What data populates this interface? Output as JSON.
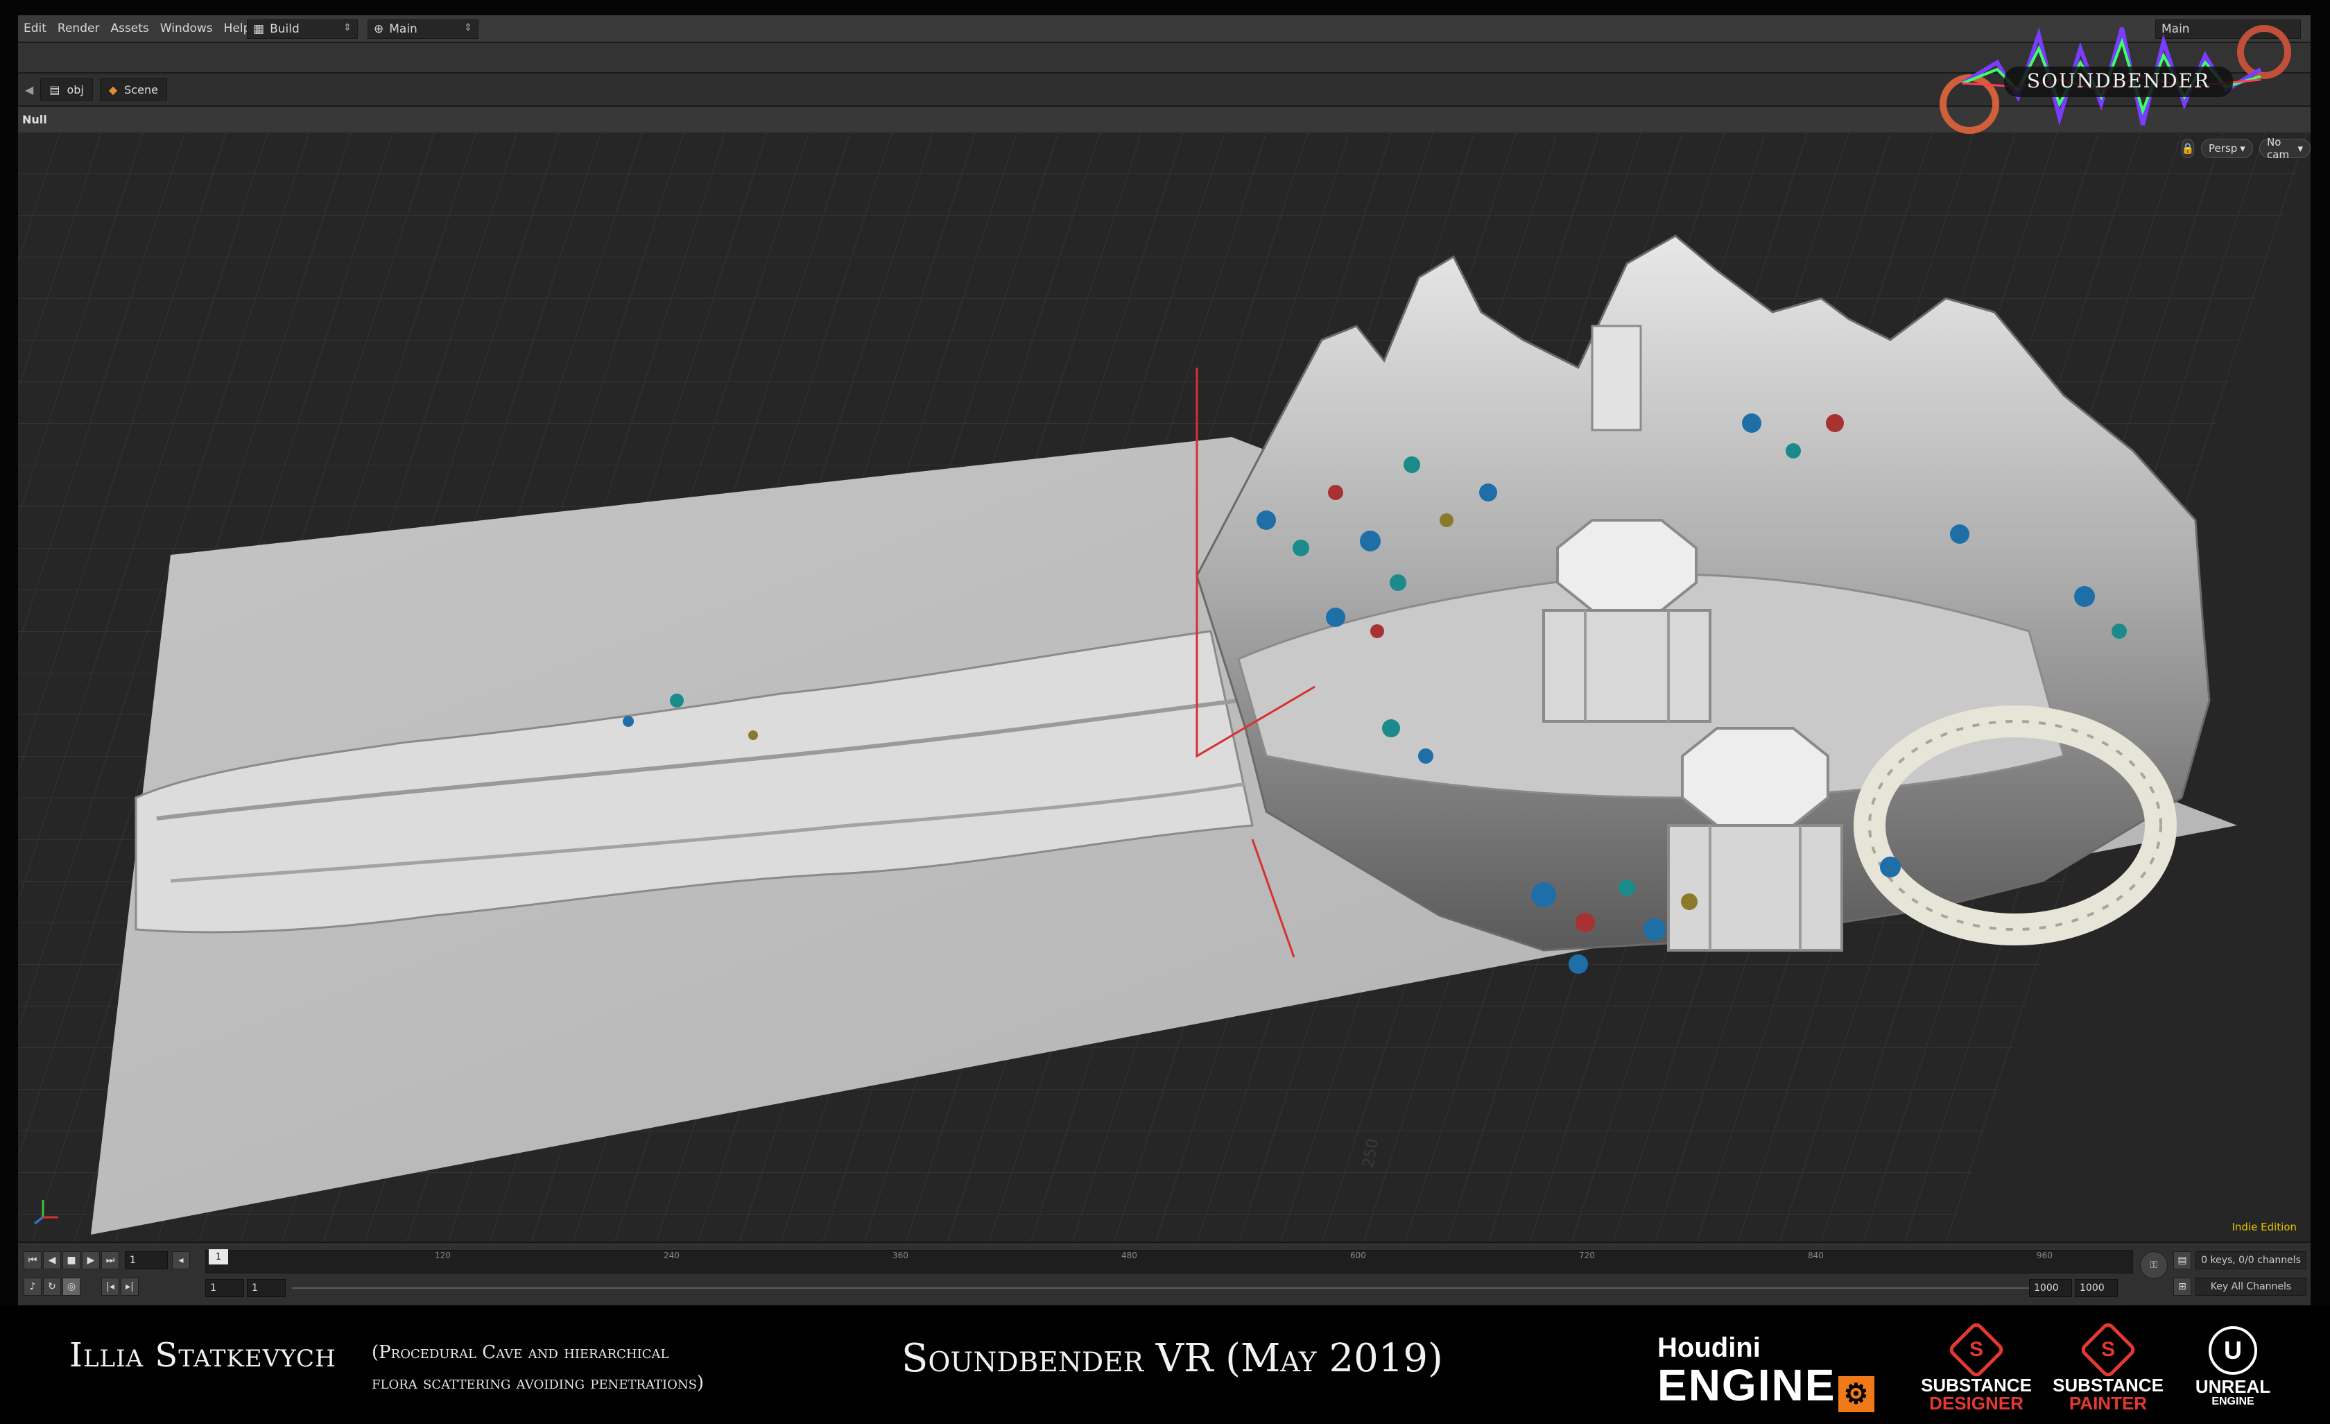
{
  "menubar": {
    "items": [
      "Edit",
      "Render",
      "Assets",
      "Windows",
      "Help"
    ],
    "desktop_select": "Build",
    "network_select": "Main",
    "right_select": "Main"
  },
  "path": {
    "level1": "obj",
    "level2": "Scene"
  },
  "parameter_header": "Null",
  "viewport": {
    "camera_view": "Persp",
    "camera": "No cam",
    "edition": "Indie Edition",
    "grid_label": "250"
  },
  "timeline": {
    "current_frame": "1",
    "marker": "1",
    "ticks": [
      "120",
      "240",
      "360",
      "480",
      "600",
      "720",
      "840",
      "960"
    ],
    "range_start": "1",
    "range_start2": "1",
    "range_end": "1000",
    "range_end2": "1000",
    "keys_status": "0 keys, 0/0 channels",
    "key_all": "Key All Channels"
  },
  "branding": {
    "game_logo": "SOUNDBENDER"
  },
  "caption": {
    "author": "Illia Statkevych",
    "note_line1": "(Procedural Cave and hierarchical",
    "note_line2": "flora scattering avoiding penetrations)",
    "title": "Soundbender VR (May 2019)",
    "houdini_line1": "Houdini",
    "houdini_line2": "ENGINE",
    "substance1_line1": "SUBSTANCE",
    "substance1_line2": "DESIGNER",
    "substance2_line1": "SUBSTANCE",
    "substance2_line2": "PAINTER",
    "unreal_line1": "UNREAL",
    "unreal_line2": "ENGINE"
  },
  "colors": {
    "accent_red": "#e23a30",
    "edition_yellow": "#e6c200",
    "flora_blue": "#1e6fa8",
    "flora_teal": "#1a8a8a",
    "flora_red": "#a83232"
  }
}
